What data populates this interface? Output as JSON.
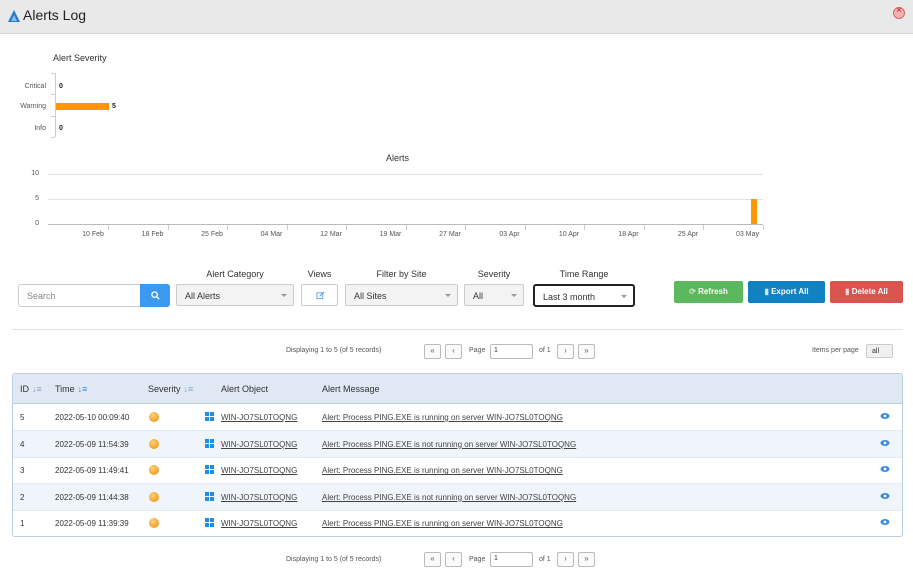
{
  "window": {
    "title": "Alerts Log"
  },
  "severity_chart": {
    "title": "Alert Severity",
    "categories": [
      "Critical",
      "Warning",
      "Info"
    ],
    "values": [
      0,
      5,
      0
    ],
    "color": "#ff9800"
  },
  "chart_data": [
    {
      "type": "bar",
      "orientation": "horizontal",
      "title": "Alert Severity",
      "categories": [
        "Critical",
        "Warning",
        "Info"
      ],
      "values": [
        0,
        5,
        0
      ]
    },
    {
      "type": "bar",
      "title": "Alerts",
      "ylim": [
        0,
        10
      ],
      "y_ticks": [
        "0",
        "5",
        "10"
      ],
      "x_ticks": [
        "10 Feb",
        "18 Feb",
        "25 Feb",
        "04 Mar",
        "12 Mar",
        "19 Mar",
        "27 Mar",
        "03 Apr",
        "10 Apr",
        "18 Apr",
        "25 Apr",
        "03 May"
      ],
      "bars": [
        {
          "x": "2022-05-09",
          "value": 5
        }
      ],
      "grid": true
    }
  ],
  "alerts_chart": {
    "title": "Alerts",
    "y_ticks": [
      "10",
      "5",
      "0"
    ],
    "x_ticks": [
      "10 Feb",
      "18 Feb",
      "25 Feb",
      "04 Mar",
      "12 Mar",
      "19 Mar",
      "27 Mar",
      "03 Apr",
      "10 Apr",
      "18 Apr",
      "25 Apr",
      "03 May"
    ]
  },
  "filters": {
    "search_placeholder": "Search",
    "alert_category_label": "Alert Category",
    "alert_category_value": "All Alerts",
    "views_label": "Views",
    "site_label": "Filter by Site",
    "site_value": "All Sites",
    "severity_label": "Severity",
    "severity_value": "All",
    "time_range_label": "Time Range",
    "time_range_value": "Last 3 month"
  },
  "actions": {
    "refresh": "Refresh",
    "export_all": "Export All",
    "delete_all": "Delete All"
  },
  "pager": {
    "displaying": "Displaying 1 to 5 (of 5 records)",
    "page_label": "Page",
    "page_value": "1",
    "of_label": "of 1",
    "items_per_page_label": "Items per page",
    "items_per_page_value": "all"
  },
  "table": {
    "headers": {
      "id": "ID",
      "time": "Time",
      "severity": "Severity",
      "object": "Alert Object",
      "message": "Alert Message"
    },
    "rows": [
      {
        "id": "5",
        "time": "2022-05-10 00:09:40",
        "object": "WIN-JO7SL0TOQNG",
        "message": "Alert: Process PING.EXE is running on server WIN-JO7SL0TOQNG"
      },
      {
        "id": "4",
        "time": "2022-05-09 11:54:39",
        "object": "WIN-JO7SL0TOQNG",
        "message": "Alert: Process PING.EXE is not running on server WIN-JO7SL0TOQNG"
      },
      {
        "id": "3",
        "time": "2022-05-09 11:49:41",
        "object": "WIN-JO7SL0TOQNG",
        "message": "Alert: Process PING.EXE is running on server WIN-JO7SL0TOQNG"
      },
      {
        "id": "2",
        "time": "2022-05-09 11:44:38",
        "object": "WIN-JO7SL0TOQNG",
        "message": "Alert: Process PING.EXE is not running on server WIN-JO7SL0TOQNG"
      },
      {
        "id": "1",
        "time": "2022-05-09 11:39:39",
        "object": "WIN-JO7SL0TOQNG",
        "message": "Alert: Process PING.EXE is running on server WIN-JO7SL0TOQNG"
      }
    ]
  }
}
